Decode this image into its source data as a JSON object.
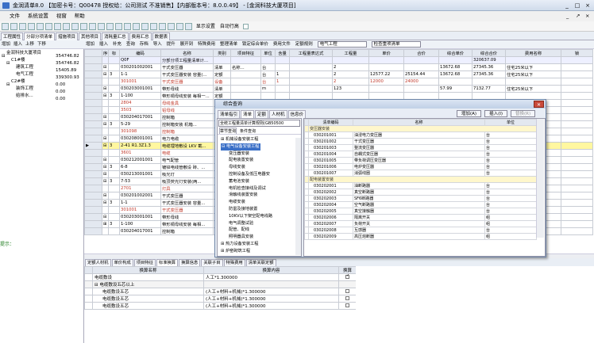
{
  "window": {
    "title": "金润清单8.0 【加密卡号：Q00478 授权给：公司测试 不准销售】【内部版本号：8.0.0.49】 - [金润科技大厦项目]",
    "controls": [
      "_",
      "□",
      "×"
    ]
  },
  "menu": [
    "文件",
    "系统设置",
    "视窗",
    "帮助"
  ],
  "menu_right_controls": [
    "_",
    "↗",
    "×"
  ],
  "toolbar": {
    "show_settings": "显示设置",
    "auto_row_height": "自动行高"
  },
  "main_tabs": [
    "工程属性",
    "分部分项清单",
    "措施项目",
    "其他项目",
    "消耗量汇总",
    "费用汇总",
    "数据表"
  ],
  "left_toolbar": [
    "增加",
    "插入",
    "上移",
    "下移"
  ],
  "left_tree": [
    {
      "name": "金润科技大厦项目",
      "value": "354746.82",
      "level": 0,
      "toggle": "⊟"
    },
    {
      "name": "C1#楼",
      "value": "354746.82",
      "level": 1,
      "toggle": "⊟"
    },
    {
      "name": "建筑工程",
      "value": "15405.89",
      "level": 2,
      "toggle": ""
    },
    {
      "name": "电气工程",
      "value": "339300.93",
      "level": 2,
      "toggle": ""
    },
    {
      "name": "C2#楼",
      "value": "0.00",
      "level": 1,
      "toggle": "⊟"
    },
    {
      "name": "装饰工程",
      "value": "0.00",
      "level": 2,
      "toggle": ""
    },
    {
      "name": "给排水...",
      "value": "0.00",
      "level": 2,
      "toggle": ""
    }
  ],
  "tip_label": "提示：",
  "grid_toolbar": {
    "items": [
      "增加",
      "插入",
      "补充",
      "查询",
      "存档",
      "导入",
      "提升",
      "展开到",
      "特殊费用",
      "整理清单",
      "锁定综合单价",
      "费用文件",
      "定额规则"
    ],
    "combo1": "电气工程",
    "combo2": "检查重项清单"
  },
  "grid": {
    "headers": [
      "序号",
      "标",
      "编码",
      "名称",
      "类别",
      "项目特征",
      "单位",
      "含量",
      "工程量表达式",
      "工程量",
      "单价",
      "合价",
      "综合单价",
      "综合合价",
      "费用名称",
      "锁"
    ],
    "rows": [
      {
        "cls": "r-qd",
        "cells": [
          "",
          "",
          "Q0F",
          "分部分项工程量清单计...",
          "",
          "",
          "",
          "",
          "",
          "",
          "",
          "",
          "",
          "320637.09",
          "",
          ""
        ]
      },
      {
        "cls": "",
        "cells": [
          "⊟ 1",
          "",
          "030201002001",
          "干式变压器",
          "清单",
          "名称...",
          "台",
          "",
          "",
          "2",
          "",
          "",
          "13672.68",
          "27345.36",
          "住宅25米以下",
          ""
        ]
      },
      {
        "cls": "",
        "cells": [
          "⊟",
          "3",
          "1-1",
          "干式变压器安装 容量(...",
          "定额",
          "",
          "台",
          "1",
          "",
          "2",
          "12577.22",
          "25154.44",
          "13672.68",
          "27345.36",
          "住宅25米以下",
          ""
        ]
      },
      {
        "cls": "r-sub",
        "cells": [
          "",
          "",
          "301001",
          "干式变压器",
          "设备",
          "",
          "台",
          "1",
          "",
          "2",
          "12000",
          "24000",
          "",
          "",
          "",
          ""
        ]
      },
      {
        "cls": "",
        "cells": [
          "⊟ 2",
          "",
          "030203001001",
          "带形母线",
          "清单",
          "",
          "m",
          "",
          "",
          "123",
          "",
          "",
          "57.99",
          "7132.77",
          "住宅25米以下",
          ""
        ]
      },
      {
        "cls": "",
        "cells": [
          "⊟",
          "3",
          "1-100",
          "带形铜母线安装 每相一...",
          "定额",
          "",
          "",
          "",
          "",
          "",
          "",
          "",
          "",
          "",
          "",
          ""
        ]
      },
      {
        "cls": "r-sub",
        "cells": [
          "",
          "",
          "2804",
          "母线金具",
          "",
          "",
          "",
          "",
          "",
          "",
          "",
          "",
          "",
          "",
          "",
          ""
        ]
      },
      {
        "cls": "r-sub",
        "cells": [
          "",
          "",
          "3503",
          "铝母线",
          "",
          "",
          "",
          "",
          "",
          "",
          "",
          "",
          "",
          "",
          "",
          ""
        ]
      },
      {
        "cls": "",
        "cells": [
          "⊟ 3",
          "",
          "030204017001",
          "控制箱",
          "",
          "",
          "",
          "",
          "",
          "",
          "",
          "",
          "",
          "",
          "",
          ""
        ]
      },
      {
        "cls": "",
        "cells": [
          "⊟",
          "3",
          "5-29",
          "控制箱安装 机箱...",
          "",
          "",
          "",
          "",
          "",
          "",
          "",
          "",
          "",
          "",
          "",
          ""
        ]
      },
      {
        "cls": "r-sub",
        "cells": [
          "",
          "",
          "301098",
          "控制箱",
          "",
          "",
          "",
          "",
          "",
          "",
          "",
          "",
          "",
          "",
          "",
          ""
        ]
      },
      {
        "cls": "",
        "cells": [
          "⊟ 4",
          "",
          "030208001001",
          "电力电缆",
          "",
          "",
          "",
          "",
          "",
          "",
          "",
          "",
          "",
          "",
          "",
          ""
        ]
      },
      {
        "cls": "r-sel",
        "cells": [
          "⊟",
          "3",
          "2-41 R1.3Z1.3",
          "电缆埋地敷设 LKV 截...",
          "",
          "",
          "",
          "",
          "",
          "",
          "",
          "",
          "",
          "",
          "",
          ""
        ]
      },
      {
        "cls": "r-sub",
        "cells": [
          "",
          "",
          "3601",
          "电缆",
          "",
          "",
          "",
          "",
          "",
          "",
          "",
          "",
          "",
          "",
          "",
          ""
        ]
      },
      {
        "cls": "",
        "cells": [
          "⊟ 5",
          "",
          "030212001001",
          "电气配管",
          "",
          "",
          "",
          "",
          "",
          "",
          "",
          "",
          "",
          "",
          "",
          ""
        ]
      },
      {
        "cls": "",
        "cells": [
          "⊟",
          "3",
          "6-8",
          "镀锌电线管敷设 砖、...",
          "",
          "",
          "",
          "",
          "",
          "",
          "",
          "",
          "",
          "",
          "",
          ""
        ]
      },
      {
        "cls": "",
        "cells": [
          "⊟ 6",
          "",
          "030213001001",
          "吸光灯",
          "",
          "",
          "",
          "",
          "",
          "",
          "",
          "",
          "",
          "",
          "",
          ""
        ]
      },
      {
        "cls": "",
        "cells": [
          "⊟",
          "3",
          "7-53",
          "吸顶荧光灯安装(两...",
          "",
          "",
          "",
          "",
          "",
          "",
          "",
          "",
          "",
          "",
          "",
          ""
        ]
      },
      {
        "cls": "r-sub",
        "cells": [
          "",
          "",
          "2701",
          "灯具",
          "",
          "",
          "",
          "",
          "",
          "",
          "",
          "",
          "",
          "",
          "",
          ""
        ]
      },
      {
        "cls": "",
        "cells": [
          "⊟ 7",
          "",
          "030201002001",
          "干式变压器",
          "",
          "",
          "",
          "",
          "",
          "",
          "",
          "",
          "",
          "",
          "",
          ""
        ]
      },
      {
        "cls": "",
        "cells": [
          "⊟",
          "3",
          "1-1",
          "干式变压器安装 容量...",
          "",
          "",
          "",
          "",
          "",
          "",
          "",
          "",
          "",
          "",
          "",
          ""
        ]
      },
      {
        "cls": "r-sub",
        "cells": [
          "",
          "",
          "301001",
          "干式变压器",
          "",
          "",
          "",
          "",
          "",
          "",
          "",
          "",
          "",
          "",
          "",
          ""
        ]
      },
      {
        "cls": "",
        "cells": [
          "⊟ 8",
          "",
          "030203001001",
          "带形母线",
          "",
          "",
          "",
          "",
          "",
          "",
          "",
          "",
          "",
          "",
          "",
          ""
        ]
      },
      {
        "cls": "",
        "cells": [
          "⊞",
          "3",
          "1-100",
          "带形铜母线安装 每相...",
          "",
          "",
          "",
          "",
          "",
          "",
          "",
          "",
          "",
          "",
          "",
          ""
        ]
      },
      {
        "cls": "",
        "cells": [
          "",
          "",
          "030204017001",
          "控制箱",
          "",
          "",
          "",
          "",
          "",
          "",
          "",
          "",
          "",
          "",
          "",
          ""
        ]
      }
    ]
  },
  "bottom_tabs": [
    "定额人材机",
    "单价构成",
    "项目特征",
    "标准换算",
    "换算信息",
    "关联子目",
    "特殊费用",
    "清单关联定额"
  ],
  "bottom_grid": {
    "headers": [
      "换算名称",
      "换算内容",
      "换算"
    ],
    "rows": [
      {
        "name": "电缆敷设",
        "content": "人工*1.300000",
        "checked": true,
        "indent": 0
      },
      {
        "name": "⊟ 电缆敷设五芯以上",
        "content": "",
        "checked": false,
        "indent": 0,
        "group": true
      },
      {
        "name": "电缆敷设五芯",
        "content": "(人工+材料+机械)*1.300000",
        "checked": false,
        "indent": 1
      },
      {
        "name": "电缆敷设五芯",
        "content": "(人工+材料+机械)*1.300000",
        "checked": false,
        "indent": 1
      },
      {
        "name": "电缆敷设五芯",
        "content": "(人工+材料+机械)*1.300000",
        "checked": false,
        "indent": 1
      }
    ]
  },
  "dialog": {
    "title": "综合查询",
    "tabs": [
      "清单指引",
      "清单",
      "定额",
      "人材机",
      "信息价"
    ],
    "buttons": [
      "增加(A)",
      "插入(I)",
      "替换(R)"
    ],
    "combo": "全统工程量清单计算规则(GB50500",
    "sub_tabs": [
      "章节查询",
      "条件查询"
    ],
    "tree": [
      {
        "t": "⊞ 机械设备安装工程",
        "l": 0
      },
      {
        "t": "⊟ 电气设备安装工程",
        "l": 0,
        "sel": true
      },
      {
        "t": "变压器安装",
        "l": 1
      },
      {
        "t": "配电装置安装",
        "l": 1
      },
      {
        "t": "母线安装",
        "l": 1
      },
      {
        "t": "控制设备及低压电器安",
        "l": 1
      },
      {
        "t": "蓄电池安装",
        "l": 1
      },
      {
        "t": "电机检查接线及调试",
        "l": 1
      },
      {
        "t": "滑触线装置安装",
        "l": 1
      },
      {
        "t": "电缆安装",
        "l": 1
      },
      {
        "t": "防雷及接地装置",
        "l": 1
      },
      {
        "t": "10KV以下架空配电线路",
        "l": 1
      },
      {
        "t": "电气调整试验",
        "l": 1
      },
      {
        "t": "配管、配线",
        "l": 1
      },
      {
        "t": "照明器具安装",
        "l": 1
      },
      {
        "t": "⊞ 热力设备安装工程",
        "l": 0
      },
      {
        "t": "⊞ 炉窑砌筑工程",
        "l": 0
      }
    ],
    "table_headers": [
      "清单编码",
      "名称",
      "单位"
    ],
    "table_rows": [
      {
        "code": "变压器安装",
        "name": "",
        "unit": "",
        "group": true
      },
      {
        "code": "030201001",
        "name": "油浸电力变压器",
        "unit": "台"
      },
      {
        "code": "030201002",
        "name": "干式变压器",
        "unit": "台"
      },
      {
        "code": "030201003",
        "name": "整流变压器",
        "unit": "台"
      },
      {
        "code": "030201004",
        "name": "自耦式变压器",
        "unit": "台"
      },
      {
        "code": "030201005",
        "name": "带负荷调压变压器",
        "unit": "台"
      },
      {
        "code": "030201006",
        "name": "电炉变压器",
        "unit": "台"
      },
      {
        "code": "030201007",
        "name": "消弧线圈",
        "unit": "台"
      },
      {
        "code": "配电装置安装",
        "name": "",
        "unit": "",
        "group": true
      },
      {
        "code": "030202001",
        "name": "油断路器",
        "unit": "台"
      },
      {
        "code": "030202002",
        "name": "真空断路器",
        "unit": "台"
      },
      {
        "code": "030202003",
        "name": "SF6断路器",
        "unit": "台"
      },
      {
        "code": "030202004",
        "name": "空气断路器",
        "unit": "台"
      },
      {
        "code": "030202005",
        "name": "真空接触器",
        "unit": "台"
      },
      {
        "code": "030202006",
        "name": "隔离开关",
        "unit": "组"
      },
      {
        "code": "030202007",
        "name": "负荷开关",
        "unit": "组"
      },
      {
        "code": "030202008",
        "name": "互感器",
        "unit": "台"
      },
      {
        "code": "030202009",
        "name": "高压熔断器",
        "unit": "组"
      }
    ]
  }
}
